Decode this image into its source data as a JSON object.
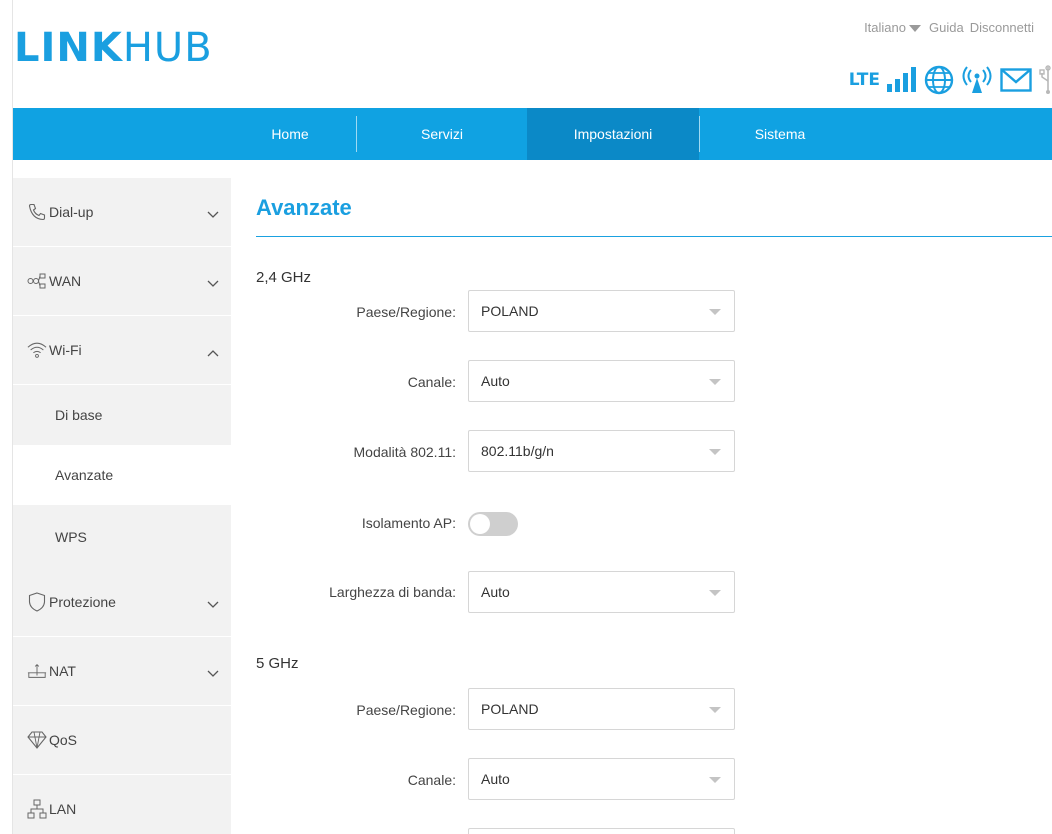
{
  "header": {
    "logo_bold": "LINK",
    "logo_light": "HUB",
    "language": "Italiano",
    "help": "Guida",
    "logout": "Disconnetti",
    "network_type": "LTE"
  },
  "nav": {
    "items": [
      {
        "label": "Home"
      },
      {
        "label": "Servizi"
      },
      {
        "label": "Impostazioni",
        "active": true
      },
      {
        "label": "Sistema"
      }
    ]
  },
  "sidebar": {
    "items": [
      {
        "label": "Dial-up",
        "icon": "phone-icon",
        "expanded": false
      },
      {
        "label": "WAN",
        "icon": "wan-icon",
        "expanded": false
      },
      {
        "label": "Wi-Fi",
        "icon": "wifi-icon",
        "expanded": true
      },
      {
        "label": "Protezione",
        "icon": "shield-icon",
        "expanded": false
      },
      {
        "label": "NAT",
        "icon": "nat-icon",
        "expanded": false
      },
      {
        "label": "QoS",
        "icon": "qos-icon"
      },
      {
        "label": "LAN",
        "icon": "lan-icon"
      }
    ],
    "wifi_sub": [
      {
        "label": "Di base"
      },
      {
        "label": "Avanzate",
        "active": true
      },
      {
        "label": "WPS"
      }
    ]
  },
  "content": {
    "title": "Avanzate",
    "band_24": {
      "label": "2,4 GHz",
      "country_label": "Paese/Regione:",
      "country_value": "POLAND",
      "channel_label": "Canale:",
      "channel_value": "Auto",
      "mode_label": "Modalità 802.11:",
      "mode_value": "802.11b/g/n",
      "isolation_label": "Isolamento AP:",
      "isolation_on": false,
      "bandwidth_label": "Larghezza di banda:",
      "bandwidth_value": "Auto"
    },
    "band_5": {
      "label": "5 GHz",
      "country_label": "Paese/Regione:",
      "country_value": "POLAND",
      "channel_label": "Canale:",
      "channel_value": "Auto"
    }
  },
  "colors": {
    "brand": "#1a9fe0",
    "nav_bg": "#10a2e2",
    "nav_active": "#0b89c7",
    "sidebar_bg": "#f2f2f2"
  }
}
